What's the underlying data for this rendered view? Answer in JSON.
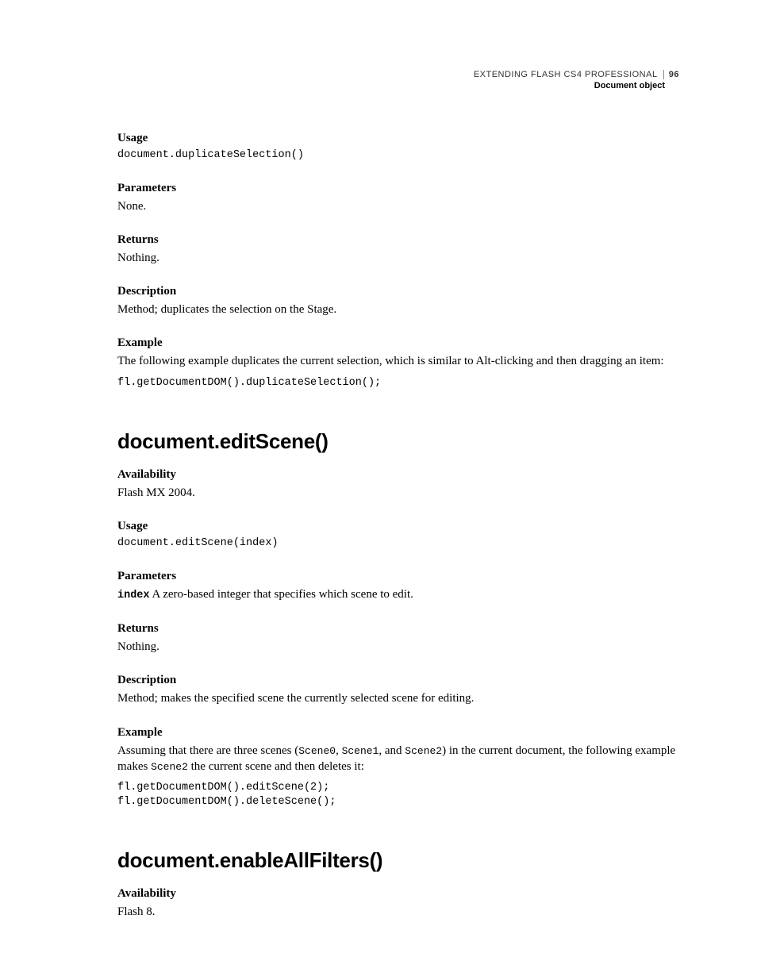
{
  "header": {
    "title": "EXTENDING FLASH CS4 PROFESSIONAL",
    "page_number": "96",
    "subtitle": "Document object"
  },
  "sections": [
    {
      "usage_label": "Usage",
      "usage_code": "document.duplicateSelection()",
      "parameters_label": "Parameters",
      "parameters_text": "None.",
      "returns_label": "Returns",
      "returns_text": "Nothing.",
      "description_label": "Description",
      "description_text": "Method; duplicates the selection on the Stage.",
      "example_label": "Example",
      "example_text": "The following example duplicates the current selection, which is similar to Alt-clicking and then dragging an item:",
      "example_code": "fl.getDocumentDOM().duplicateSelection();"
    }
  ],
  "method1": {
    "title": "document.editScene()",
    "availability_label": "Availability",
    "availability_text": "Flash MX 2004.",
    "usage_label": "Usage",
    "usage_code": "document.editScene(index)",
    "parameters_label": "Parameters",
    "param_name": "index",
    "param_desc": "  A zero-based integer that specifies which scene to edit.",
    "returns_label": "Returns",
    "returns_text": "Nothing.",
    "description_label": "Description",
    "description_text": "Method; makes the specified scene the currently selected scene for editing.",
    "example_label": "Example",
    "example_text_pre": "Assuming that there are three scenes (",
    "example_scene0": "Scene0",
    "example_sep1": ", ",
    "example_scene1": "Scene1",
    "example_sep2": ", and ",
    "example_scene2": "Scene2",
    "example_text_mid": ") in the current document, the following example makes ",
    "example_scene2b": "Scene2",
    "example_text_post": " the current scene and then deletes it:",
    "example_code": "fl.getDocumentDOM().editScene(2);\nfl.getDocumentDOM().deleteScene();"
  },
  "method2": {
    "title": "document.enableAllFilters()",
    "availability_label": "Availability",
    "availability_text": "Flash 8."
  }
}
